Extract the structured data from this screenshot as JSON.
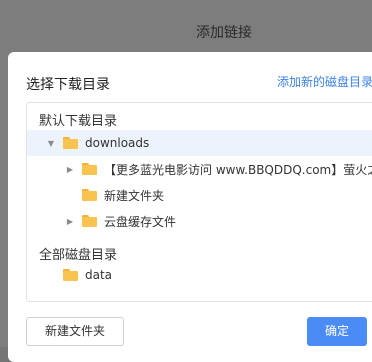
{
  "parent_dialog": {
    "title": "添加链接"
  },
  "dialog": {
    "title": "选择下载目录",
    "add_disk_link": "添加新的磁盘目录"
  },
  "tree": {
    "default_section_label": "默认下载目录",
    "default_root": {
      "label": "downloads",
      "expanded": true,
      "selected": true
    },
    "children": [
      {
        "label": "【更多蓝光电影访问 www.BBQDDQ.com】萤火之森",
        "has_children": true
      },
      {
        "label": "新建文件夹",
        "has_children": false
      },
      {
        "label": "云盘缓存文件",
        "has_children": true
      }
    ],
    "all_disks_section_label": "全部磁盘目录",
    "disks": [
      {
        "label": "data"
      }
    ]
  },
  "buttons": {
    "new_folder": "新建文件夹",
    "confirm": "确定"
  },
  "colors": {
    "accent": "#4a8bf5",
    "link": "#3b82e6",
    "folder": "#f8c34e",
    "selected_row": "#edf3fc"
  }
}
